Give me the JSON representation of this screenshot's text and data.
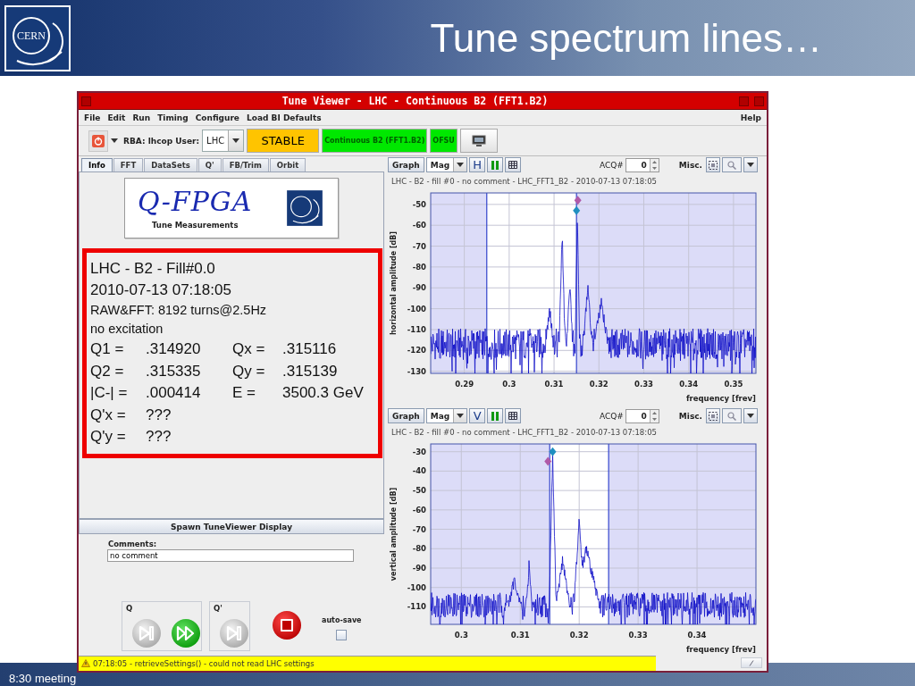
{
  "slide": {
    "logo_text": "CERN",
    "title": "Tune spectrum lines…",
    "footer": "8:30 meeting"
  },
  "window": {
    "title": "Tune Viewer - LHC - Continuous B2 (FFT1.B2)"
  },
  "menu": [
    {
      "label": "File"
    },
    {
      "label": "Edit"
    },
    {
      "label": "Run"
    },
    {
      "label": "Timing"
    },
    {
      "label": "Configure"
    },
    {
      "label": "Load BI Defaults"
    }
  ],
  "help_menu": "Help",
  "toolbar": {
    "rba_label": "RBA: lhcop User:",
    "user": "LHC",
    "indicators": [
      {
        "kind": "beam_mode",
        "text": "STABLE",
        "color": "#ffc400"
      },
      {
        "kind": "tag",
        "text": "Continuous B2 (FFT1.B2)",
        "color": "#00e800"
      },
      {
        "kind": "tag",
        "text": "OFSU",
        "color": "#00e800"
      }
    ]
  },
  "tabs": [
    {
      "label": "Info",
      "selected": true
    },
    {
      "label": "FFT",
      "selected": false
    },
    {
      "label": "DataSets",
      "selected": false
    },
    {
      "label": "Q'",
      "selected": false
    },
    {
      "label": "FB/Trim",
      "selected": false
    },
    {
      "label": "Orbit",
      "selected": false
    }
  ],
  "logo": {
    "title": "Q-FPGA",
    "subtitle": "Tune Measurements"
  },
  "info_lines": [
    {
      "kind": "heading",
      "text": "LHC - B2 - Fill#0.0"
    },
    {
      "kind": "heading",
      "text": "2010-07-13 07:18:05"
    },
    {
      "kind": "note",
      "text": "RAW&FFT: 8192 turns@2.5Hz"
    },
    {
      "kind": "note",
      "text": "no excitation"
    },
    {
      "kind": "values",
      "cells": [
        "Q1 =",
        ".314920",
        "Qx =",
        ".315116"
      ]
    },
    {
      "kind": "values",
      "cells": [
        "Q2 =",
        ".315335",
        "Qy =",
        ".315139"
      ]
    },
    {
      "kind": "values",
      "cells": [
        "|C-| =",
        ".000414",
        "E =",
        "3500.3 GeV"
      ]
    },
    {
      "kind": "values",
      "cells": [
        "Q'x =",
        "???"
      ]
    },
    {
      "kind": "values",
      "cells": [
        "Q'y =",
        "???"
      ]
    }
  ],
  "spawn_button": "Spawn TuneViewer Display",
  "comments": {
    "label": "Comments:",
    "value": "no comment"
  },
  "controls": {
    "groups": [
      {
        "label": "Q",
        "buttons": [
          {
            "kind": "step",
            "disabled": true
          },
          {
            "kind": "run",
            "disabled": false
          }
        ]
      },
      {
        "label": "Q'",
        "buttons": [
          {
            "kind": "step",
            "disabled": true
          }
        ]
      }
    ],
    "buttons": [
      {
        "kind": "stop",
        "disabled": false
      }
    ],
    "auto_save": {
      "label": "auto-save",
      "checked": false
    }
  },
  "charts": [
    {
      "graph": "Graph",
      "mode": "Mag",
      "plane": "H",
      "acq_label": "ACQ#",
      "acq": "0",
      "misc": "Misc.",
      "subtitle": "LHC - B2 - fill #0 - no comment - LHC_FFT1_B2 - 2010-07-13 07:18:05",
      "ylabel": "horizontal amplitude [dB]",
      "yticks": [
        "-50",
        "-60",
        "-70",
        "-80",
        "-90",
        "-100",
        "-110",
        "-120",
        "-130"
      ],
      "xticks": [
        "0.29",
        "0.3",
        "0.31",
        "0.32",
        "0.33",
        "0.34",
        "0.35"
      ],
      "xlabel": "frequency [frev]"
    },
    {
      "graph": "Graph",
      "mode": "Mag",
      "plane": "V",
      "acq_label": "ACQ#",
      "acq": "0",
      "misc": "Misc.",
      "subtitle": "LHC - B2 - fill #0 - no comment - LHC_FFT1_B2 - 2010-07-13 07:18:05",
      "ylabel": "vertical amplitude [dB]",
      "yticks": [
        "-30",
        "-40",
        "-50",
        "-60",
        "-70",
        "-80",
        "-90",
        "-100",
        "-110"
      ],
      "xticks": [
        "0.3",
        "0.31",
        "0.32",
        "0.33",
        "0.34"
      ],
      "xlabel": "frequency [frev]"
    }
  ],
  "status_bar": {
    "message": "07:18:05 - retrieveSettings() - could not read LHC settings"
  }
}
